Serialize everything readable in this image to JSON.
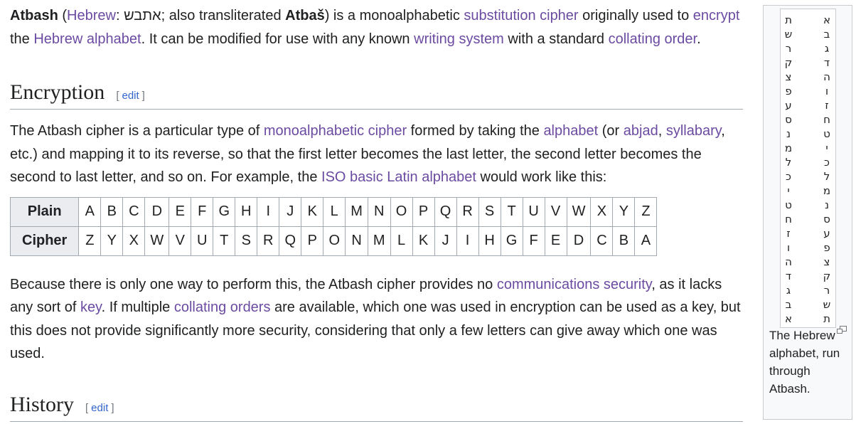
{
  "intro": {
    "title_word": "Atbash",
    "paren_open": " (",
    "hebrew_link": "Hebrew",
    "hebrew_term": ": אתבש; also transliterated ",
    "translit": "Atbaš",
    "after_translit": ") is a monoalphabetic ",
    "link_substitution": "substitution cipher",
    "t1": " originally used to ",
    "link_encrypt": "encrypt",
    "t2": " the ",
    "link_hebrew_alphabet": "Hebrew alphabet",
    "t3": ". It can be modified for use with any known ",
    "link_writing_system": "writing system",
    "t4": " with a standard ",
    "link_collating_order": "collating order",
    "t5": "."
  },
  "sections": {
    "encryption": {
      "title": "Encryption",
      "edit": "edit",
      "bracket_open": "[",
      "bracket_close": "]"
    },
    "history": {
      "title": "History",
      "edit": "edit",
      "bracket_open": "[",
      "bracket_close": "]"
    }
  },
  "enc_para": {
    "t1": "The Atbash cipher is a particular type of ",
    "link_mono": "monoalphabetic cipher",
    "t2": " formed by taking the ",
    "link_alphabet": "alphabet",
    "t3": " (or ",
    "link_abjad": "abjad",
    "t4": ", ",
    "link_syllabary": "syllabary",
    "t5": ", etc.) and mapping it to its reverse, so that the first letter becomes the last letter, the second letter becomes the second to last letter, and so on. For example, the ",
    "link_iso": "ISO basic Latin alphabet",
    "t6": " would work like this:"
  },
  "cipher_table": {
    "plain_label": "Plain",
    "cipher_label": "Cipher",
    "plain": [
      "A",
      "B",
      "C",
      "D",
      "E",
      "F",
      "G",
      "H",
      "I",
      "J",
      "K",
      "L",
      "M",
      "N",
      "O",
      "P",
      "Q",
      "R",
      "S",
      "T",
      "U",
      "V",
      "W",
      "X",
      "Y",
      "Z"
    ],
    "cipher": [
      "Z",
      "Y",
      "X",
      "W",
      "V",
      "U",
      "T",
      "S",
      "R",
      "Q",
      "P",
      "O",
      "N",
      "M",
      "L",
      "K",
      "J",
      "I",
      "H",
      "G",
      "F",
      "E",
      "D",
      "C",
      "B",
      "A"
    ]
  },
  "security_para": {
    "t1": "Because there is only one way to perform this, the Atbash cipher provides no ",
    "link_comm": "communications security",
    "t2": ", as it lacks any sort of ",
    "link_key": "key",
    "t3": ". If multiple ",
    "link_collating": "collating orders",
    "t4": " are available, which one was used in encryption can be used as a key, but this does not provide significantly more security, considering that only a few letters can give away which one was used."
  },
  "thumb": {
    "left_column": [
      "ת",
      "ש",
      "ר",
      "ק",
      "צ",
      "פ",
      "ע",
      "ס",
      "נ",
      "מ",
      "ל",
      "כ",
      "י",
      "ט",
      "ח",
      "ז",
      "ו",
      "ה",
      "ד",
      "ג",
      "ב",
      "א"
    ],
    "right_column": [
      "א",
      "ב",
      "ג",
      "ד",
      "ה",
      "ו",
      "ז",
      "ח",
      "ט",
      "י",
      "כ",
      "ל",
      "מ",
      "נ",
      "ס",
      "ע",
      "פ",
      "צ",
      "ק",
      "ר",
      "ש",
      "ת"
    ],
    "caption": "The Hebrew alphabet, run through Atbash.",
    "magnify_icon": "magnify-clip-icon"
  },
  "colors": {
    "link": "#3366cc",
    "visited_link": "#6b4ba1",
    "text": "#202122",
    "table_header_bg": "#eaecf0",
    "border": "#a2a9b1"
  }
}
